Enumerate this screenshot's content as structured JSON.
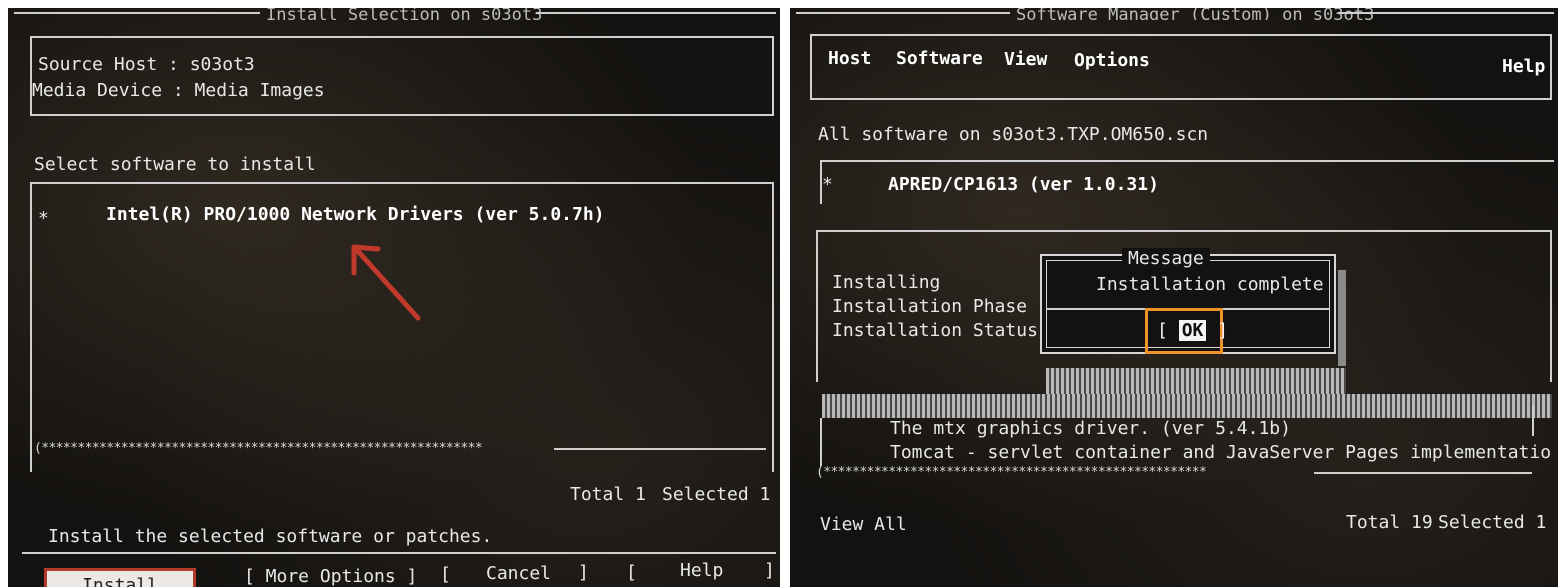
{
  "left": {
    "title": "Install Selection on s03ot3",
    "source_host": "Source Host : s03ot3",
    "media_device": "Media Device : Media Images",
    "select_prompt": "Select software to install",
    "list_items": [
      {
        "marker": "*",
        "label": "Intel(R) PRO/1000 Network Drivers (ver 5.0.7h)"
      }
    ],
    "scroll_stars": "(*************************************************************",
    "total": "Total 1",
    "selected": "Selected 1",
    "hint": "Install the selected software or patches.",
    "buttons": {
      "install": "Install",
      "more_options": "[ More Options ]",
      "cancel_open": "[",
      "cancel": "Cancel",
      "cancel_close": "]",
      "help_open": "[",
      "help": "Help",
      "help_close": "]"
    },
    "colors": {
      "highlight": "#b13a2a"
    }
  },
  "right": {
    "title": "Software Manager (Custom) on s03ot3",
    "menu": {
      "host": "Host",
      "software": "Software",
      "view": "View",
      "options": "Options",
      "help": "Help"
    },
    "all_software": "All software on s03ot3.TXP.OM650.scn",
    "top_item": {
      "marker": "*",
      "label": "APRED/CP1613 (ver 1.0.31)"
    },
    "progress_labels": [
      "Installing",
      "Installation Phase",
      "Installation Status"
    ],
    "message": {
      "title": "Message",
      "text": "Installation complete",
      "ok_open": "[",
      "ok": "OK",
      "ok_close": "]"
    },
    "list_items": [
      "The mtx graphics driver. (ver 5.4.1b)",
      "Tomcat - servlet container and JavaServer Pages implementation (ver v"
    ],
    "scroll_stars": "(*****************************************************",
    "view_all": "View All",
    "total": "Total 19",
    "selected": "Selected 1",
    "colors": {
      "highlight": "#f0912a"
    }
  }
}
